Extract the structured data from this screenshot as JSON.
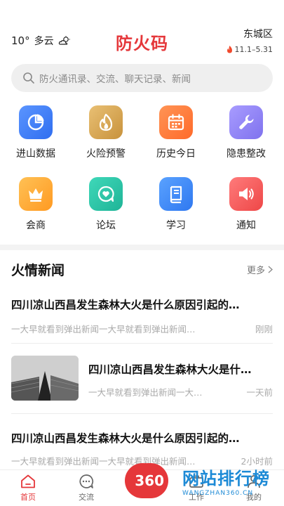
{
  "header": {
    "temperature": "10°",
    "condition": "多云",
    "title": "防火码",
    "district": "东城区",
    "period": "11.1–5.31"
  },
  "search": {
    "placeholder": "防火通讯录、交流、聊天记录、新闻"
  },
  "grid": [
    {
      "label": "进山数据",
      "icon": "pie-chart-icon",
      "color": "#3f7cf3"
    },
    {
      "label": "火险预警",
      "icon": "flame-icon",
      "color": "#d9a64c"
    },
    {
      "label": "历史今日",
      "icon": "calendar-icon",
      "color": "#ff7a3d"
    },
    {
      "label": "隐患整改",
      "icon": "wrench-icon",
      "color": "#8f83f2"
    },
    {
      "label": "会商",
      "icon": "crown-icon",
      "color": "#ffad3a"
    },
    {
      "label": "论坛",
      "icon": "heart-chat-icon",
      "color": "#2cc6a8"
    },
    {
      "label": "学习",
      "icon": "book-icon",
      "color": "#3f8cf3"
    },
    {
      "label": "通知",
      "icon": "speaker-icon",
      "color": "#f25a5a"
    }
  ],
  "news": {
    "section_title": "火情新闻",
    "more_label": "更多",
    "items": [
      {
        "headline": "四川凉山西昌发生森林大火是什么原因引起的…",
        "summary": "一大早就看到弹出新闻一大早就看到弹出新闻…",
        "time": "刚刚"
      },
      {
        "headline": "四川凉山西昌发生森林大火是什…",
        "summary": "一大早就看到弹出新闻一大…",
        "time": "一天前"
      },
      {
        "headline": "四川凉山西昌发生森林大火是什么原因引起的…",
        "summary": "一大早就看到弹出新闻一大早就看到弹出新闻…",
        "time": "2小时前"
      }
    ]
  },
  "tabbar": {
    "tabs": [
      {
        "label": "首页",
        "icon": "home-icon"
      },
      {
        "label": "交流",
        "icon": "chat-icon"
      },
      {
        "label": "工作",
        "icon": "briefcase-icon"
      },
      {
        "label": "我的",
        "icon": "user-icon"
      }
    ]
  },
  "watermark": {
    "badge": "360",
    "text": "网站排行榜",
    "sub": "WANGZHAN360.CN"
  },
  "colors": {
    "accent": "#e5373a",
    "watermark": "#1d8ad6"
  }
}
